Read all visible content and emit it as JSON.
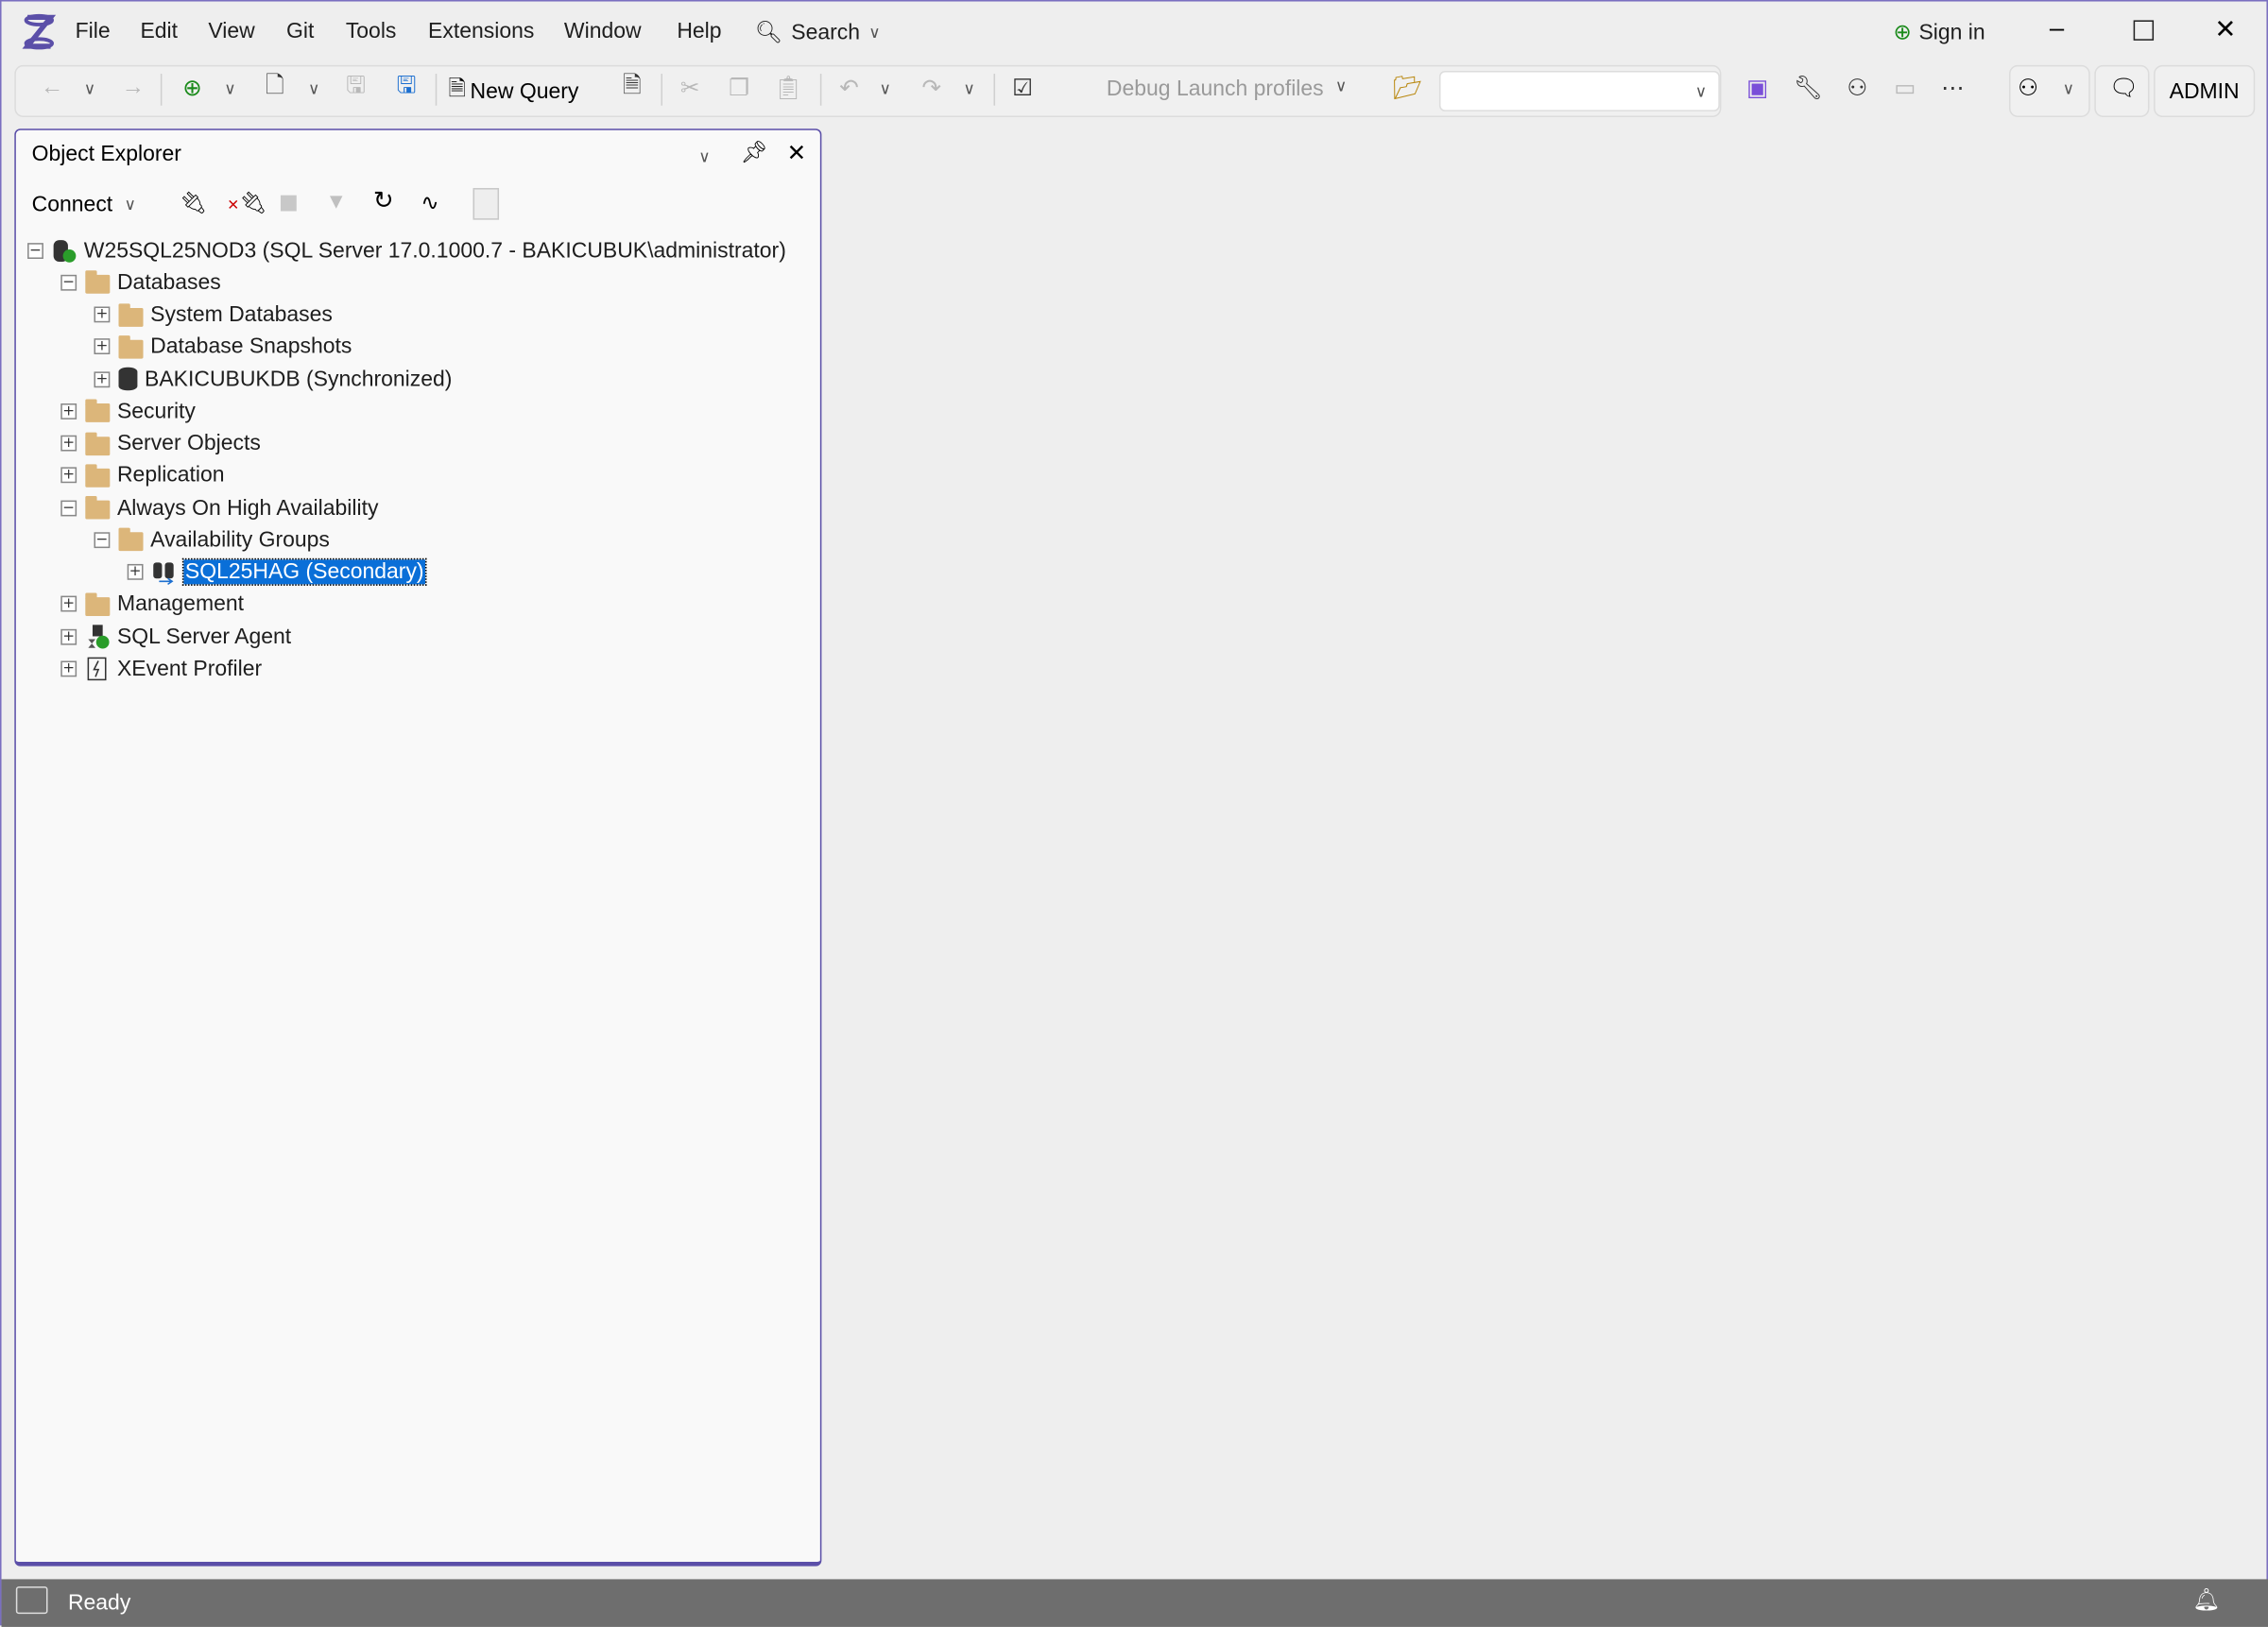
{
  "menu": {
    "items": [
      "File",
      "Edit",
      "View",
      "Git",
      "Tools",
      "Extensions",
      "Window",
      "Help"
    ],
    "search": "Search",
    "sign_in": "Sign in"
  },
  "toolbar": {
    "new_query": "New Query",
    "debug_launch": "Debug Launch profiles",
    "combo_value": "",
    "admin": "ADMIN"
  },
  "object_explorer": {
    "title": "Object Explorer",
    "connect": "Connect",
    "tree": [
      {
        "label": "W25SQL25NOD3 (SQL Server 17.0.1000.7 - BAKICUBUK\\administrator)",
        "level": 0,
        "expander": "−",
        "icon": "server"
      },
      {
        "label": "Databases",
        "level": 1,
        "expander": "−",
        "icon": "folder"
      },
      {
        "label": "System Databases",
        "level": 2,
        "expander": "+",
        "icon": "folder"
      },
      {
        "label": "Database Snapshots",
        "level": 2,
        "expander": "+",
        "icon": "folder"
      },
      {
        "label": "BAKICUBUKDB (Synchronized)",
        "level": 2,
        "expander": "+",
        "icon": "database"
      },
      {
        "label": "Security",
        "level": 1,
        "expander": "+",
        "icon": "folder"
      },
      {
        "label": "Server Objects",
        "level": 1,
        "expander": "+",
        "icon": "folder"
      },
      {
        "label": "Replication",
        "level": 1,
        "expander": "+",
        "icon": "folder"
      },
      {
        "label": "Always On High Availability",
        "level": 1,
        "expander": "−",
        "icon": "folder"
      },
      {
        "label": "Availability Groups",
        "level": 2,
        "expander": "−",
        "icon": "folder"
      },
      {
        "label": "SQL25HAG (Secondary)",
        "level": 3,
        "expander": "+",
        "icon": "availability-group",
        "selected": true
      },
      {
        "label": "Management",
        "level": 1,
        "expander": "+",
        "icon": "folder"
      },
      {
        "label": "SQL Server Agent",
        "level": 1,
        "expander": "+",
        "icon": "agent"
      },
      {
        "label": "XEvent Profiler",
        "level": 1,
        "expander": "+",
        "icon": "xevent"
      }
    ]
  },
  "status": {
    "text": "Ready"
  },
  "colors": {
    "accent": "#5b4fa8",
    "selection": "#0a6fd8",
    "status_bar": "#6e6e6e"
  }
}
